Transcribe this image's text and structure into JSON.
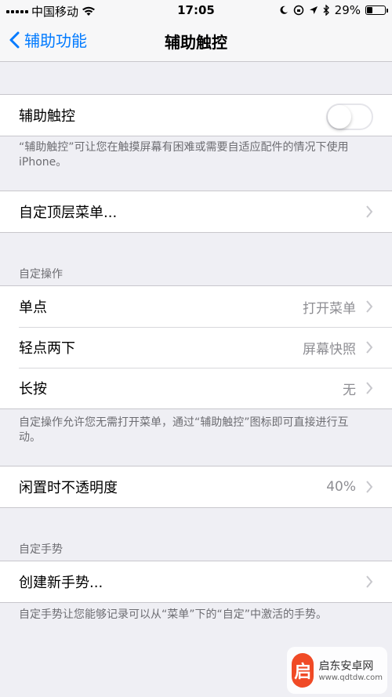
{
  "status_bar": {
    "carrier": "中国移动",
    "time": "17:05",
    "battery": "29%"
  },
  "nav": {
    "back_label": "辅助功能",
    "title": "辅助触控"
  },
  "assistive_touch": {
    "label": "辅助触控",
    "enabled": false,
    "footer": "“辅助触控”可让您在触摸屏幕有困难或需要自适应配件的情况下使用 iPhone。"
  },
  "top_menu": {
    "label": "自定顶层菜单..."
  },
  "custom_actions": {
    "header": "自定操作",
    "rows": [
      {
        "label": "单点",
        "value": "打开菜单"
      },
      {
        "label": "轻点两下",
        "value": "屏幕快照"
      },
      {
        "label": "长按",
        "value": "无"
      }
    ],
    "footer": "自定操作允许您无需打开菜单，通过“辅助触控”图标即可直接进行互动。"
  },
  "idle_opacity": {
    "label": "闲置时不透明度",
    "value": "40%"
  },
  "custom_gestures": {
    "header": "自定手势",
    "create_label": "创建新手势...",
    "footer": "自定手势让您能够记录可以从“菜单”下的“自定”中激活的手势。"
  },
  "watermark": {
    "name": "启东安卓网",
    "url": "www.qdtdw.com"
  },
  "colors": {
    "accent": "#007aff",
    "background": "#efeff4",
    "secondary_text": "#8e8e93"
  }
}
